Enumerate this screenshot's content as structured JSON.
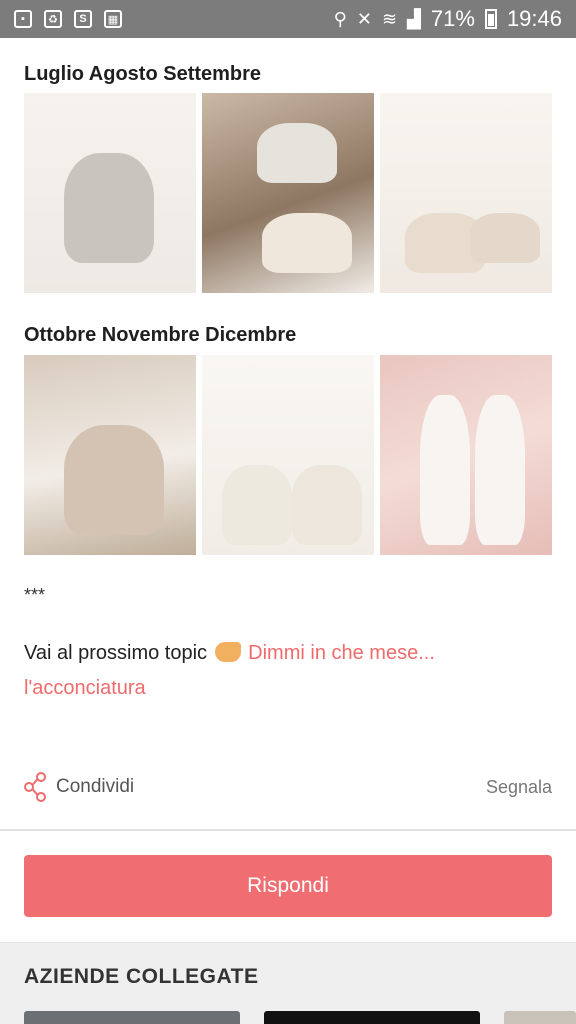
{
  "status_bar": {
    "battery": "71%",
    "time": "19:46"
  },
  "sections": [
    {
      "title": "Luglio Agosto Settembre"
    },
    {
      "title": "Ottobre Novembre Dicembre"
    }
  ],
  "separator": "***",
  "next_topic": {
    "prefix": "Vai al prossimo topic",
    "link_text": "Dimmi in che mese... l'acconciatura"
  },
  "actions": {
    "share_label": "Condividi",
    "report_label": "Segnala"
  },
  "reply_button": "Rispondi",
  "related": {
    "title": "AZIENDE COLLEGATE"
  },
  "colors": {
    "accent": "#f06e72",
    "link": "#ef6b6b"
  }
}
